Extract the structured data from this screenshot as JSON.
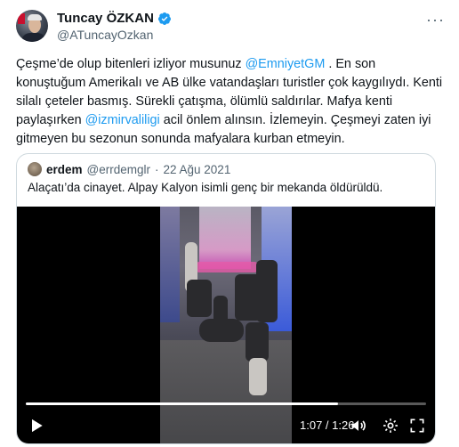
{
  "author": {
    "display_name": "Tuncay ÖZKAN",
    "handle": "@ATuncayOzkan",
    "more_label": "···"
  },
  "tweet": {
    "seg1": "Çeşme’de olup bitenleri izliyor musunuz ",
    "mention1": "@EmniyetGM",
    "seg2": " . En son konuştuğum Amerikalı ve AB ülke vatandaşları turistler çok kaygılıydı. Kenti silalı çeteler basmış. Sürekli çatışma, ölümlü saldırılar. Mafya kenti paylaşırken ",
    "mention2": "@izmirvaliligi",
    "seg3": "  acil önlem alınsın. İzlemeyin. Çeşmeyi zaten iyi gitmeyen bu sezonun sonunda mafyalara kurban etmeyin."
  },
  "quote": {
    "name": "erdem",
    "handle": "@errdemglr",
    "separator": "·",
    "date": "22 Ağu 2021",
    "text": "Alaçatı’da cinayet. Alpay Kalyon isimli genç bir mekanda öldürüldü."
  },
  "video": {
    "time_label": "1:07 / 1:26",
    "progress": 0.78
  },
  "colors": {
    "accent": "#1d9bf0",
    "text": "#0f1419",
    "muted": "#536471",
    "border": "#cfd9de"
  }
}
